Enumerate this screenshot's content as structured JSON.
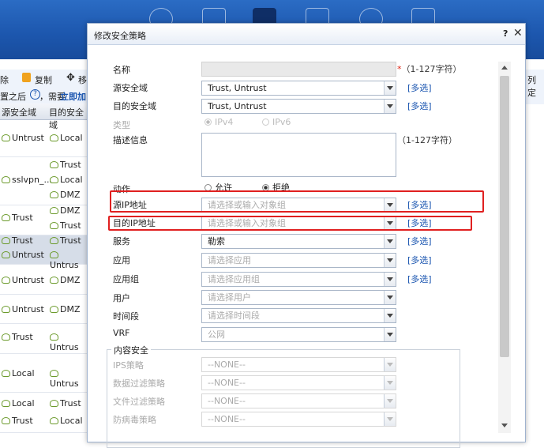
{
  "background": {
    "toolbar": {
      "delete": "除",
      "copy": "复制",
      "move": "移",
      "hint_prefix": "置之后",
      "hint_suffix": "，需要",
      "apply_link": "立即加"
    },
    "grid_headers": [
      "源安全域",
      "目的安全域"
    ],
    "rows": [
      {
        "src": [
          "Untrust"
        ],
        "dst": [
          "Local"
        ]
      },
      {
        "src": [
          "sslvpn_..."
        ],
        "dst": [
          "Trust",
          "Local",
          "DMZ"
        ]
      },
      {
        "src": [
          "Trust"
        ],
        "dst": [
          "DMZ",
          "Trust"
        ]
      },
      {
        "src": [
          "Trust",
          "Untrust"
        ],
        "dst": [
          "Trust",
          "Untrus"
        ],
        "selected": true
      },
      {
        "src": [
          "Untrust"
        ],
        "dst": [
          "DMZ"
        ]
      },
      {
        "src": [
          "Untrust"
        ],
        "dst": [
          "DMZ"
        ]
      },
      {
        "src": [
          "Trust"
        ],
        "dst": [
          "Untrus"
        ]
      },
      {
        "src": [
          "Local"
        ],
        "dst": [
          "Untrus"
        ]
      },
      {
        "src": [
          "Local",
          "Trust"
        ],
        "dst": [
          "Trust",
          "Local"
        ]
      }
    ],
    "right_header": "列定"
  },
  "dialog": {
    "title": "修改安全策略",
    "help": "?",
    "close": "✕",
    "name": {
      "label": "名称",
      "value": "",
      "hint": "（1-127字符）",
      "required_mark": "*"
    },
    "src_zone": {
      "label": "源安全域",
      "value": "Trust, Untrust",
      "more": "[多选]"
    },
    "dst_zone": {
      "label": "目的安全域",
      "value": "Trust, Untrust",
      "more": "[多选]"
    },
    "type": {
      "label": "类型",
      "options": [
        "IPv4",
        "IPv6"
      ],
      "selected": "IPv4"
    },
    "description": {
      "label": "描述信息",
      "value": "",
      "hint": "（1-127字符）"
    },
    "action": {
      "label": "动作",
      "options": [
        "允许",
        "拒绝"
      ],
      "selected": "拒绝"
    },
    "src_ip": {
      "label": "源IP地址",
      "placeholder": "请选择或输入对象组",
      "more": "[多选]"
    },
    "dst_ip": {
      "label": "目的IP地址",
      "placeholder": "请选择或输入对象组",
      "more": "[多选]"
    },
    "service": {
      "label": "服务",
      "value": "勒索",
      "more": "[多选]"
    },
    "application": {
      "label": "应用",
      "placeholder": "请选择应用",
      "more": "[多选]"
    },
    "app_group": {
      "label": "应用组",
      "placeholder": "请选择应用组",
      "more": "[多选]"
    },
    "user": {
      "label": "用户",
      "placeholder": "请选择用户"
    },
    "time_range": {
      "label": "时间段",
      "placeholder": "请选择时间段"
    },
    "vrf": {
      "label": "VRF",
      "value": "公网"
    },
    "content_security": {
      "legend": "内容安全",
      "items": [
        {
          "label": "IPS策略",
          "value": "--NONE--"
        },
        {
          "label": "数据过滤策略",
          "value": "--NONE--"
        },
        {
          "label": "文件过滤策略",
          "value": "--NONE--"
        },
        {
          "label": "防病毒策略",
          "value": "--NONE--"
        }
      ]
    },
    "highlight_color": "#e02020",
    "link_color": "#1a55b0"
  }
}
